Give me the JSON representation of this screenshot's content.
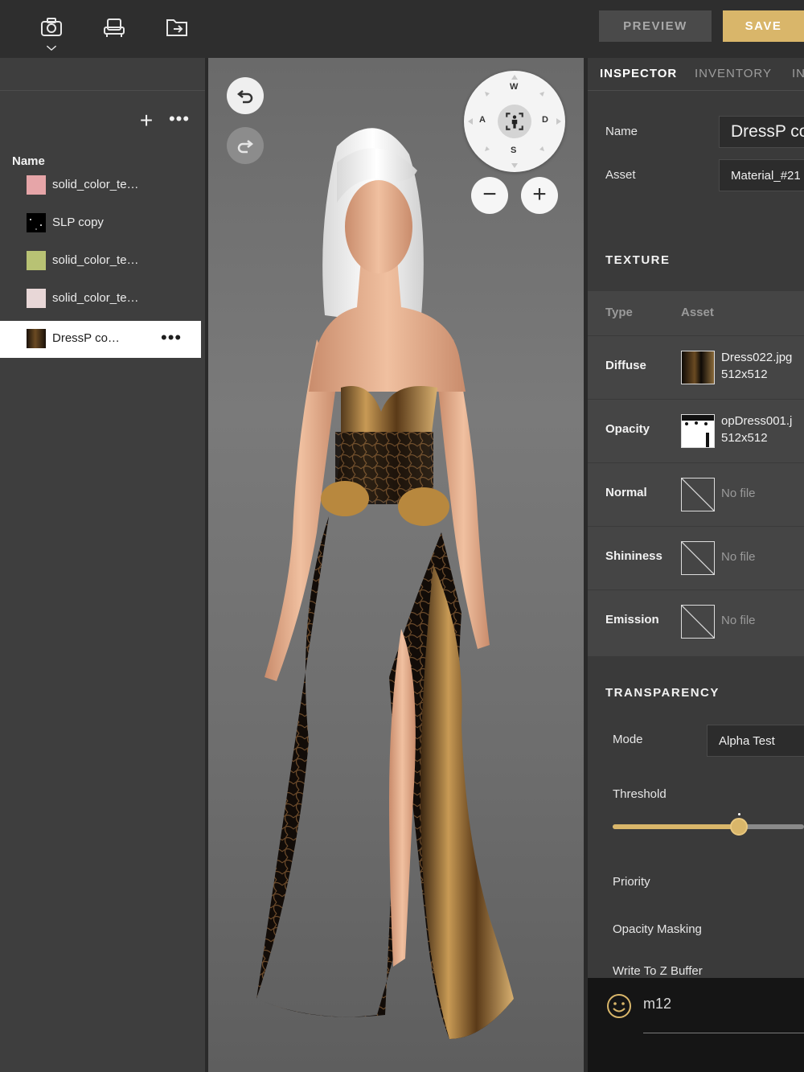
{
  "toolbar": {
    "icons": [
      "camera-icon",
      "furniture-icon",
      "export-icon"
    ],
    "preview_label": "PREVIEW",
    "save_label": "SAVE",
    "colors": {
      "save": "#d9b66a",
      "preview": "#4a4a4a"
    }
  },
  "left_panel": {
    "add_label": "+",
    "more_label": "•••",
    "column_header": "Name",
    "items": [
      {
        "label": "solid_color_te…",
        "color": "#e6a5a8"
      },
      {
        "label": "SLP copy",
        "color": "#000000"
      },
      {
        "label": "solid_color_te…",
        "color": "#b8c274"
      },
      {
        "label": "solid_color_te…",
        "color": "#e8d7d7"
      },
      {
        "label": "DressP co…",
        "color": "#3a2a1a",
        "selected": true,
        "more": "•••"
      }
    ]
  },
  "viewport": {
    "compass": {
      "north": "W",
      "west": "A",
      "east": "D",
      "south": "S"
    },
    "zoom_out": "−",
    "zoom_in": "+"
  },
  "inspector": {
    "tabs": [
      "INSPECTOR",
      "INVENTORY",
      "IN"
    ],
    "name_label": "Name",
    "name_value": "DressP co",
    "asset_label": "Asset",
    "asset_value": "Material_#21",
    "texture_section": "TEXTURE",
    "texture_header_type": "Type",
    "texture_header_asset": "Asset",
    "textures": [
      {
        "type": "Diffuse",
        "file": "Dress022.jpg",
        "size": "512x512"
      },
      {
        "type": "Opacity",
        "file": "opDress001.j",
        "size": "512x512"
      },
      {
        "type": "Normal",
        "file": "No file"
      },
      {
        "type": "Shininess",
        "file": "No file"
      },
      {
        "type": "Emission",
        "file": "No file"
      }
    ],
    "transparency_section": "TRANSPARENCY",
    "mode_label": "Mode",
    "mode_value": "Alpha Test",
    "threshold_label": "Threshold",
    "threshold_value": 0.66,
    "priority_label": "Priority",
    "opacity_masking_label": "Opacity Masking",
    "write_z_label": "Write To Z Buffer"
  },
  "chat": {
    "icon": "smiley-icon",
    "text": "m12"
  }
}
